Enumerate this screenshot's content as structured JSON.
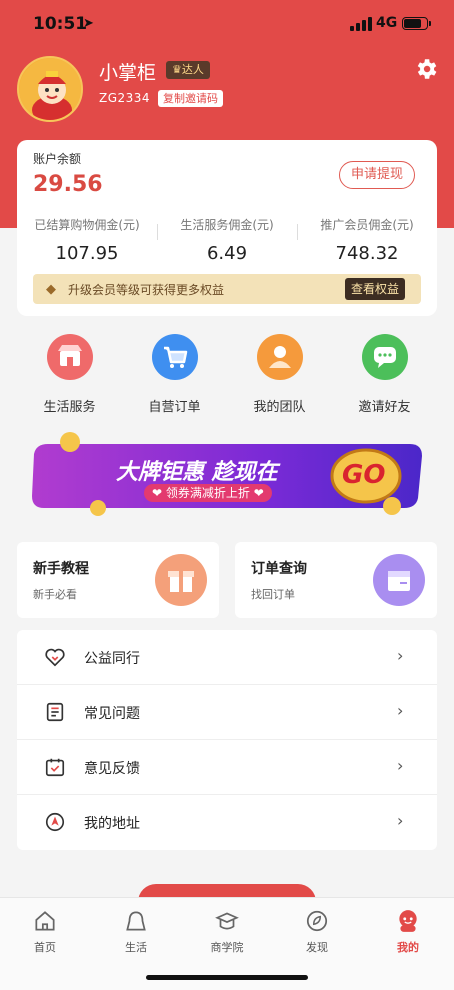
{
  "status_bar": {
    "time": "10:51",
    "network": "4G"
  },
  "profile": {
    "name": "小掌柜",
    "level_badge": "达人",
    "user_id": "ZG2334",
    "copy_invite_label": "复制邀请码"
  },
  "balance": {
    "label": "账户余额",
    "value": "29.56",
    "withdraw_label": "申请提现",
    "stats": [
      {
        "label": "已结算购物佣金(元)",
        "value": "107.95"
      },
      {
        "label": "生活服务佣金(元)",
        "value": "6.49"
      },
      {
        "label": "推广会员佣金(元)",
        "value": "748.32"
      }
    ],
    "upgrade_text": "升级会员等级可获得更多权益",
    "upgrade_button": "查看权益"
  },
  "quick_actions": [
    {
      "label": "生活服务",
      "icon": "shop-icon",
      "color": "#ef6a6a"
    },
    {
      "label": "自营订单",
      "icon": "cart-icon",
      "color": "#3f8ff0"
    },
    {
      "label": "我的团队",
      "icon": "team-icon",
      "color": "#f59a3c"
    },
    {
      "label": "邀请好友",
      "icon": "chat-icon",
      "color": "#4cbf5a"
    }
  ],
  "banner": {
    "title": "大牌钜惠 趁现在",
    "subtitle": "领券满减折上折",
    "go": "GO"
  },
  "cards": [
    {
      "title": "新手教程",
      "subtitle": "新手必看",
      "icon": "gift-icon",
      "color": "#f4a07a"
    },
    {
      "title": "订单查询",
      "subtitle": "找回订单",
      "icon": "box-icon",
      "color": "#a98ef0"
    }
  ],
  "menu": [
    {
      "label": "公益同行",
      "icon": "heart-icon"
    },
    {
      "label": "常见问题",
      "icon": "list-icon"
    },
    {
      "label": "意见反馈",
      "icon": "calendar-check-icon"
    },
    {
      "label": "我的地址",
      "icon": "location-icon"
    }
  ],
  "tabs": [
    {
      "label": "首页",
      "icon": "home-icon",
      "active": false
    },
    {
      "label": "生活",
      "icon": "life-icon",
      "active": false
    },
    {
      "label": "商学院",
      "icon": "school-icon",
      "active": false
    },
    {
      "label": "发现",
      "icon": "discover-icon",
      "active": false
    },
    {
      "label": "我的",
      "icon": "profile-icon",
      "active": true
    }
  ],
  "colors": {
    "brand_red": "#e24a48",
    "gold": "#f3e2b8"
  }
}
